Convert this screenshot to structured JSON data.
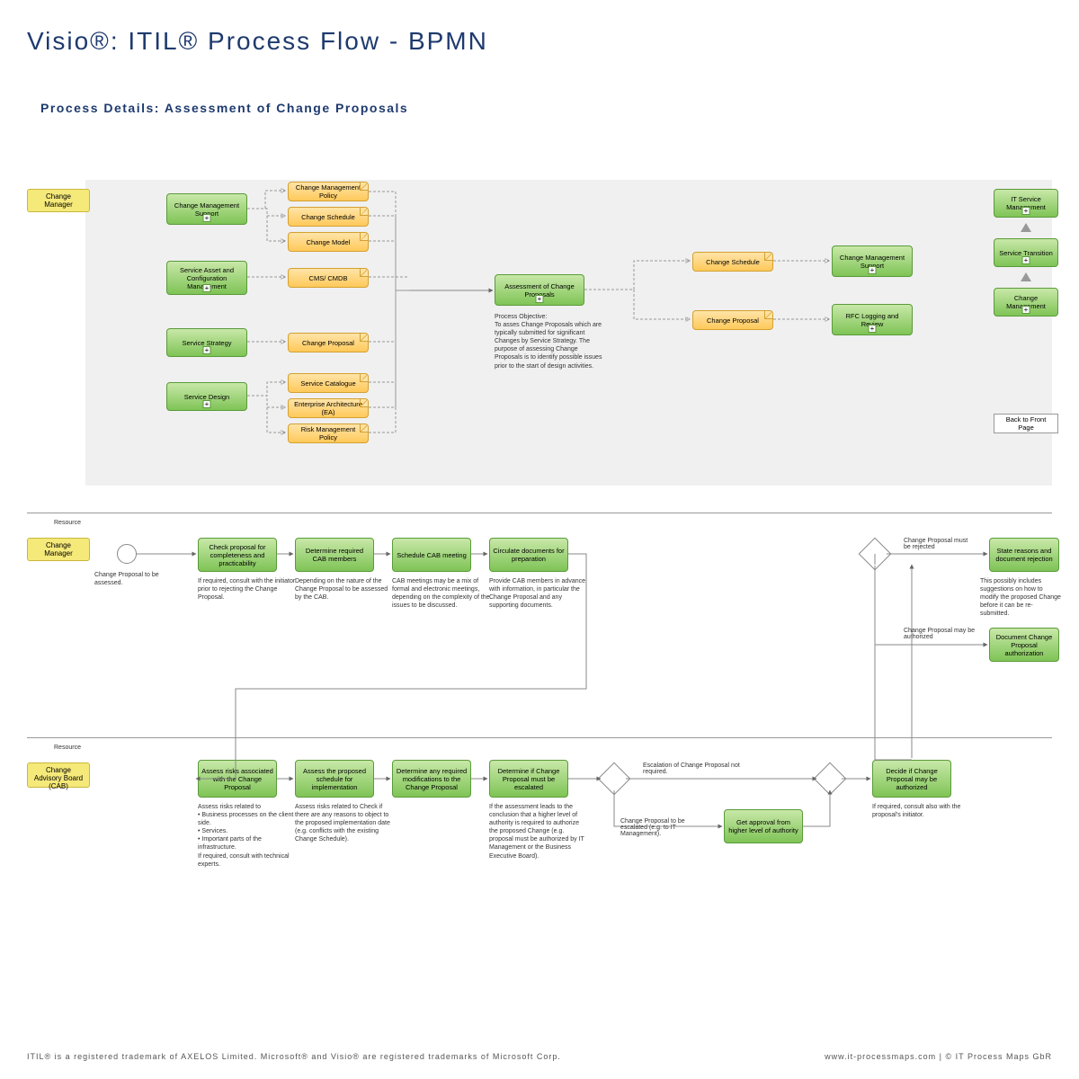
{
  "title": "Visio®: ITIL® Process Flow - BPMN",
  "subtitle": "Process Details: Assessment of Change Proposals",
  "lanes": {
    "change_manager": "Change Manager",
    "resource": "Resource",
    "change_manager2": "Change Manager",
    "resource2": "Resource",
    "cab": "Change Advisory Board (CAB)"
  },
  "inputs_green": {
    "cms": "Change Management Support",
    "sacm": "Service Asset and Configuration Management",
    "strategy": "Service Strategy",
    "design": "Service Design"
  },
  "inputs_orange": {
    "cmp": "Change Management Policy",
    "csched": "Change Schedule",
    "cmodel": "Change Model",
    "cmdb": "CMS/ CMDB",
    "cprop": "Change Proposal",
    "scat": "Service Catalogue",
    "ea": "Enterprise Architecture (EA)",
    "rmp": "Risk Management Policy"
  },
  "center": {
    "assess": "Assessment of Change Proposals",
    "objective": "Process Objective:\nTo asses Change Proposals which are typically submitted for significant Changes by Service Strategy. The purpose of assessing Change Proposals is to identify possible issues prior to the start of design activities."
  },
  "outputs_orange": {
    "csched2": "Change Schedule",
    "cprop2": "Change Proposal"
  },
  "outputs_green": {
    "cms2": "Change Management Support",
    "rfc": "RFC Logging and Review"
  },
  "right_nav": {
    "itsm": "IT Service Management",
    "st": "Service Transition",
    "cm": "Change Management",
    "back": "Back to Front Page"
  },
  "flow_top": {
    "start_label": "Change Proposal to be assessed.",
    "check": "Check proposal for completeness and practicability",
    "check_desc": "If required, consult with the initiator prior to rejecting the Change Proposal.",
    "determine": "Determine required CAB members",
    "determine_desc": "Depending on the nature of the Change Proposal to be assessed by the CAB.",
    "schedule": "Schedule CAB meeting",
    "schedule_desc": "CAB meetings may be a mix of formal and electronic meetings, depending on the complexity of the issues to be discussed.",
    "circulate": "Circulate documents for preparation",
    "circulate_desc": "Provide CAB members in advance with information, in particular the Change Proposal and any supporting documents.",
    "gw_reject": "Change Proposal must be rejected",
    "gw_auth": "Change Proposal may be authorized",
    "state": "State reasons and document rejection",
    "state_desc": "This possibly includes suggestions on how to modify the proposed Change before it can be re-submitted.",
    "doc_auth": "Document Change Proposal authorization"
  },
  "flow_bottom": {
    "assess_risks": "Assess risks associated with the Change Proposal",
    "assess_risks_desc": "Assess risks related to\n• Business processes on the client side.\n• Services.\n• Important parts of the infrastructure.\nIf required, consult with technical experts.",
    "assess_sched": "Assess the proposed schedule for implementation",
    "assess_sched_desc": "Assess risks related to Check if there are any reasons to object to the proposed implementation date (e.g. conflicts with the existing Change Schedule).",
    "det_mods": "Determine any required modifications to the Change Proposal",
    "det_escalate": "Determine if Change Proposal must be escalated",
    "det_escalate_desc": "If the assessment leads to the conclusion that a higher level of authority is required to authorize the proposed Change (e.g. proposal must be authorized by IT Management or the Business Executive Board).",
    "gw_esc_not": "Escalation of Change Proposal not required.",
    "gw_esc_yes": "Change Proposal to be escalated (e.g. to IT Management).",
    "approval": "Get approval from higher level of authority",
    "decide": "Decide if Change Proposal may be authorized",
    "decide_desc": "If required, consult also with the proposal's initiator."
  },
  "footer": {
    "left": "ITIL® is a registered trademark of AXELOS Limited. Microsoft® and Visio® are registered trademarks of Microsoft Corp.",
    "right": "www.it-processmaps.com | © IT Process Maps GbR"
  }
}
